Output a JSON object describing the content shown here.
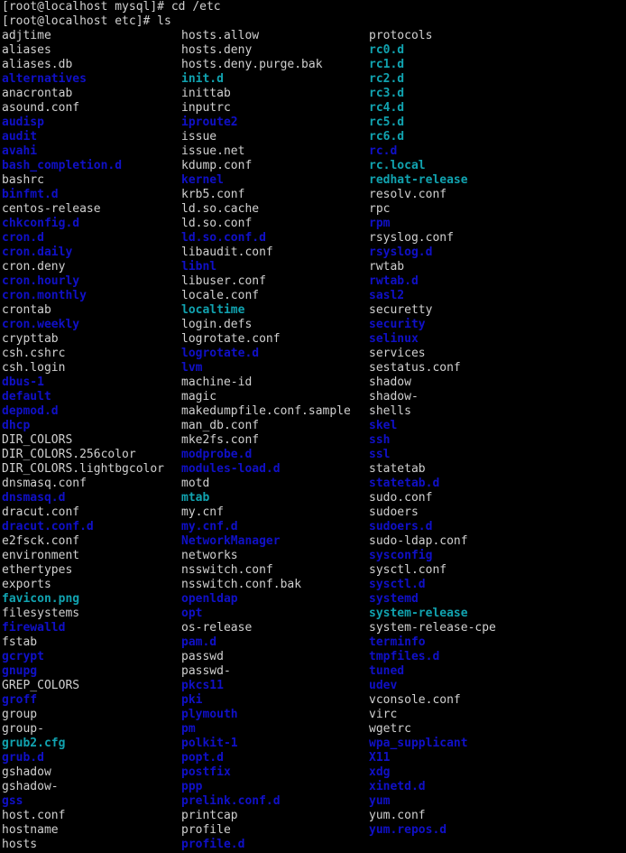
{
  "terminal": {
    "background": "#000000",
    "colors": {
      "file": "#d0d0d0",
      "dir": "#1010c8",
      "link": "#11a3b0"
    },
    "lines": [
      "[root@localhost mysql]# cd /etc",
      "[root@localhost etc]# ls"
    ]
  },
  "listing": {
    "columns": [
      [
        {
          "name": "adjtime",
          "type": "file"
        },
        {
          "name": "aliases",
          "type": "file"
        },
        {
          "name": "aliases.db",
          "type": "file"
        },
        {
          "name": "alternatives",
          "type": "dir"
        },
        {
          "name": "anacrontab",
          "type": "file"
        },
        {
          "name": "asound.conf",
          "type": "file"
        },
        {
          "name": "audisp",
          "type": "dir"
        },
        {
          "name": "audit",
          "type": "dir"
        },
        {
          "name": "avahi",
          "type": "dir"
        },
        {
          "name": "bash_completion.d",
          "type": "dir"
        },
        {
          "name": "bashrc",
          "type": "file"
        },
        {
          "name": "binfmt.d",
          "type": "dir"
        },
        {
          "name": "centos-release",
          "type": "file"
        },
        {
          "name": "chkconfig.d",
          "type": "dir"
        },
        {
          "name": "cron.d",
          "type": "dir"
        },
        {
          "name": "cron.daily",
          "type": "dir"
        },
        {
          "name": "cron.deny",
          "type": "file"
        },
        {
          "name": "cron.hourly",
          "type": "dir"
        },
        {
          "name": "cron.monthly",
          "type": "dir"
        },
        {
          "name": "crontab",
          "type": "file"
        },
        {
          "name": "cron.weekly",
          "type": "dir"
        },
        {
          "name": "crypttab",
          "type": "file"
        },
        {
          "name": "csh.cshrc",
          "type": "file"
        },
        {
          "name": "csh.login",
          "type": "file"
        },
        {
          "name": "dbus-1",
          "type": "dir"
        },
        {
          "name": "default",
          "type": "dir"
        },
        {
          "name": "depmod.d",
          "type": "dir"
        },
        {
          "name": "dhcp",
          "type": "dir"
        },
        {
          "name": "DIR_COLORS",
          "type": "file"
        },
        {
          "name": "DIR_COLORS.256color",
          "type": "file"
        },
        {
          "name": "DIR_COLORS.lightbgcolor",
          "type": "file"
        },
        {
          "name": "dnsmasq.conf",
          "type": "file"
        },
        {
          "name": "dnsmasq.d",
          "type": "dir"
        },
        {
          "name": "dracut.conf",
          "type": "file"
        },
        {
          "name": "dracut.conf.d",
          "type": "dir"
        },
        {
          "name": "e2fsck.conf",
          "type": "file"
        },
        {
          "name": "environment",
          "type": "file"
        },
        {
          "name": "ethertypes",
          "type": "file"
        },
        {
          "name": "exports",
          "type": "file"
        },
        {
          "name": "favicon.png",
          "type": "link"
        },
        {
          "name": "filesystems",
          "type": "file"
        },
        {
          "name": "firewalld",
          "type": "dir"
        },
        {
          "name": "fstab",
          "type": "file"
        },
        {
          "name": "gcrypt",
          "type": "dir"
        },
        {
          "name": "gnupg",
          "type": "dir"
        },
        {
          "name": "GREP_COLORS",
          "type": "file"
        },
        {
          "name": "groff",
          "type": "dir"
        },
        {
          "name": "group",
          "type": "file"
        },
        {
          "name": "group-",
          "type": "file"
        },
        {
          "name": "grub2.cfg",
          "type": "link"
        },
        {
          "name": "grub.d",
          "type": "dir"
        },
        {
          "name": "gshadow",
          "type": "file"
        },
        {
          "name": "gshadow-",
          "type": "file"
        },
        {
          "name": "gss",
          "type": "dir"
        },
        {
          "name": "host.conf",
          "type": "file"
        },
        {
          "name": "hostname",
          "type": "file"
        },
        {
          "name": "hosts",
          "type": "file"
        }
      ],
      [
        {
          "name": "hosts.allow",
          "type": "file"
        },
        {
          "name": "hosts.deny",
          "type": "file"
        },
        {
          "name": "hosts.deny.purge.bak",
          "type": "file"
        },
        {
          "name": "init.d",
          "type": "link"
        },
        {
          "name": "inittab",
          "type": "file"
        },
        {
          "name": "inputrc",
          "type": "file"
        },
        {
          "name": "iproute2",
          "type": "dir"
        },
        {
          "name": "issue",
          "type": "file"
        },
        {
          "name": "issue.net",
          "type": "file"
        },
        {
          "name": "kdump.conf",
          "type": "file"
        },
        {
          "name": "kernel",
          "type": "dir"
        },
        {
          "name": "krb5.conf",
          "type": "file"
        },
        {
          "name": "ld.so.cache",
          "type": "file"
        },
        {
          "name": "ld.so.conf",
          "type": "file"
        },
        {
          "name": "ld.so.conf.d",
          "type": "dir"
        },
        {
          "name": "libaudit.conf",
          "type": "file"
        },
        {
          "name": "libnl",
          "type": "dir"
        },
        {
          "name": "libuser.conf",
          "type": "file"
        },
        {
          "name": "locale.conf",
          "type": "file"
        },
        {
          "name": "localtime",
          "type": "link"
        },
        {
          "name": "login.defs",
          "type": "file"
        },
        {
          "name": "logrotate.conf",
          "type": "file"
        },
        {
          "name": "logrotate.d",
          "type": "dir"
        },
        {
          "name": "lvm",
          "type": "dir"
        },
        {
          "name": "machine-id",
          "type": "file"
        },
        {
          "name": "magic",
          "type": "file"
        },
        {
          "name": "makedumpfile.conf.sample",
          "type": "file"
        },
        {
          "name": "man_db.conf",
          "type": "file"
        },
        {
          "name": "mke2fs.conf",
          "type": "file"
        },
        {
          "name": "modprobe.d",
          "type": "dir"
        },
        {
          "name": "modules-load.d",
          "type": "dir"
        },
        {
          "name": "motd",
          "type": "file"
        },
        {
          "name": "mtab",
          "type": "link"
        },
        {
          "name": "my.cnf",
          "type": "file"
        },
        {
          "name": "my.cnf.d",
          "type": "dir"
        },
        {
          "name": "NetworkManager",
          "type": "dir"
        },
        {
          "name": "networks",
          "type": "file"
        },
        {
          "name": "nsswitch.conf",
          "type": "file"
        },
        {
          "name": "nsswitch.conf.bak",
          "type": "file"
        },
        {
          "name": "openldap",
          "type": "dir"
        },
        {
          "name": "opt",
          "type": "dir"
        },
        {
          "name": "os-release",
          "type": "file"
        },
        {
          "name": "pam.d",
          "type": "dir"
        },
        {
          "name": "passwd",
          "type": "file"
        },
        {
          "name": "passwd-",
          "type": "file"
        },
        {
          "name": "pkcs11",
          "type": "dir"
        },
        {
          "name": "pki",
          "type": "dir"
        },
        {
          "name": "plymouth",
          "type": "dir"
        },
        {
          "name": "pm",
          "type": "dir"
        },
        {
          "name": "polkit-1",
          "type": "dir"
        },
        {
          "name": "popt.d",
          "type": "dir"
        },
        {
          "name": "postfix",
          "type": "dir"
        },
        {
          "name": "ppp",
          "type": "dir"
        },
        {
          "name": "prelink.conf.d",
          "type": "dir"
        },
        {
          "name": "printcap",
          "type": "file"
        },
        {
          "name": "profile",
          "type": "file"
        },
        {
          "name": "profile.d",
          "type": "dir"
        }
      ],
      [
        {
          "name": "protocols",
          "type": "file"
        },
        {
          "name": "rc0.d",
          "type": "link"
        },
        {
          "name": "rc1.d",
          "type": "link"
        },
        {
          "name": "rc2.d",
          "type": "link"
        },
        {
          "name": "rc3.d",
          "type": "link"
        },
        {
          "name": "rc4.d",
          "type": "link"
        },
        {
          "name": "rc5.d",
          "type": "link"
        },
        {
          "name": "rc6.d",
          "type": "link"
        },
        {
          "name": "rc.d",
          "type": "dir"
        },
        {
          "name": "rc.local",
          "type": "link"
        },
        {
          "name": "redhat-release",
          "type": "link"
        },
        {
          "name": "resolv.conf",
          "type": "file"
        },
        {
          "name": "rpc",
          "type": "file"
        },
        {
          "name": "rpm",
          "type": "dir"
        },
        {
          "name": "rsyslog.conf",
          "type": "file"
        },
        {
          "name": "rsyslog.d",
          "type": "dir"
        },
        {
          "name": "rwtab",
          "type": "file"
        },
        {
          "name": "rwtab.d",
          "type": "dir"
        },
        {
          "name": "sasl2",
          "type": "dir"
        },
        {
          "name": "securetty",
          "type": "file"
        },
        {
          "name": "security",
          "type": "dir"
        },
        {
          "name": "selinux",
          "type": "dir"
        },
        {
          "name": "services",
          "type": "file"
        },
        {
          "name": "sestatus.conf",
          "type": "file"
        },
        {
          "name": "shadow",
          "type": "file"
        },
        {
          "name": "shadow-",
          "type": "file"
        },
        {
          "name": "shells",
          "type": "file"
        },
        {
          "name": "skel",
          "type": "dir"
        },
        {
          "name": "ssh",
          "type": "dir"
        },
        {
          "name": "ssl",
          "type": "dir"
        },
        {
          "name": "statetab",
          "type": "file"
        },
        {
          "name": "statetab.d",
          "type": "dir"
        },
        {
          "name": "sudo.conf",
          "type": "file"
        },
        {
          "name": "sudoers",
          "type": "file"
        },
        {
          "name": "sudoers.d",
          "type": "dir"
        },
        {
          "name": "sudo-ldap.conf",
          "type": "file"
        },
        {
          "name": "sysconfig",
          "type": "dir"
        },
        {
          "name": "sysctl.conf",
          "type": "file"
        },
        {
          "name": "sysctl.d",
          "type": "dir"
        },
        {
          "name": "systemd",
          "type": "dir"
        },
        {
          "name": "system-release",
          "type": "link"
        },
        {
          "name": "system-release-cpe",
          "type": "file"
        },
        {
          "name": "terminfo",
          "type": "dir"
        },
        {
          "name": "tmpfiles.d",
          "type": "dir"
        },
        {
          "name": "tuned",
          "type": "dir"
        },
        {
          "name": "udev",
          "type": "dir"
        },
        {
          "name": "vconsole.conf",
          "type": "file"
        },
        {
          "name": "virc",
          "type": "file"
        },
        {
          "name": "wgetrc",
          "type": "file"
        },
        {
          "name": "wpa_supplicant",
          "type": "dir"
        },
        {
          "name": "X11",
          "type": "dir"
        },
        {
          "name": "xdg",
          "type": "dir"
        },
        {
          "name": "xinetd.d",
          "type": "dir"
        },
        {
          "name": "yum",
          "type": "dir"
        },
        {
          "name": "yum.conf",
          "type": "file"
        },
        {
          "name": "yum.repos.d",
          "type": "dir"
        }
      ]
    ]
  }
}
